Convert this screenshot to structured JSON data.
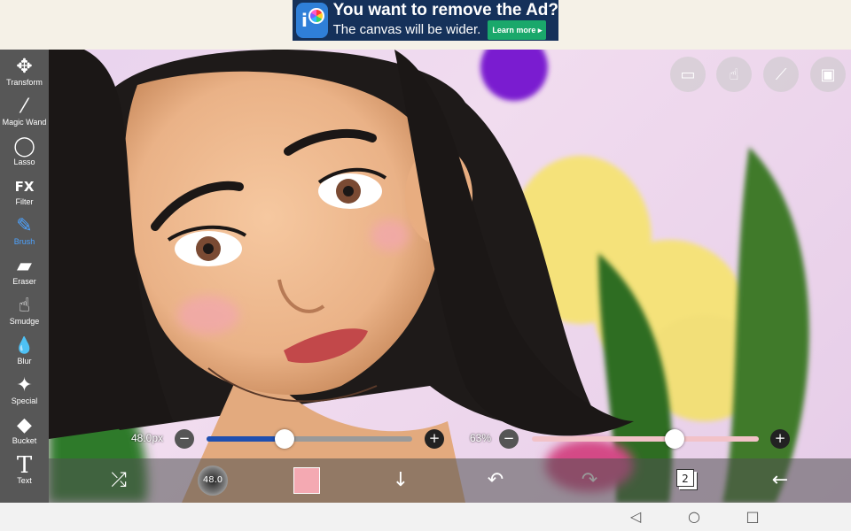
{
  "ad": {
    "title": "You want to remove the Ad?",
    "subtitle": "The canvas will be wider.",
    "button": "Learn more ▸"
  },
  "tools": [
    {
      "label": "Transform",
      "icon": "✥"
    },
    {
      "label": "Magic Wand",
      "icon": "⁄"
    },
    {
      "label": "Lasso",
      "icon": "◯"
    },
    {
      "label": "Filter",
      "icon": "FX"
    },
    {
      "label": "Brush",
      "icon": "✎"
    },
    {
      "label": "Eraser",
      "icon": "▰"
    },
    {
      "label": "Smudge",
      "icon": "☝"
    },
    {
      "label": "Blur",
      "icon": "💧"
    },
    {
      "label": "Special",
      "icon": "✦"
    },
    {
      "label": "Bucket",
      "icon": "◆"
    },
    {
      "label": "Text",
      "icon": "T"
    }
  ],
  "sliders": {
    "size_label": "48.0px",
    "size_fraction": 0.38,
    "opacity_label": "63%",
    "opacity_fraction": 0.63
  },
  "bottom": {
    "brush_size": "48.0",
    "layers_count": "2"
  },
  "colors": {
    "toolbar": "#575757",
    "active_tool": "#4da3ff",
    "brush_color": "#f4a9b2"
  }
}
